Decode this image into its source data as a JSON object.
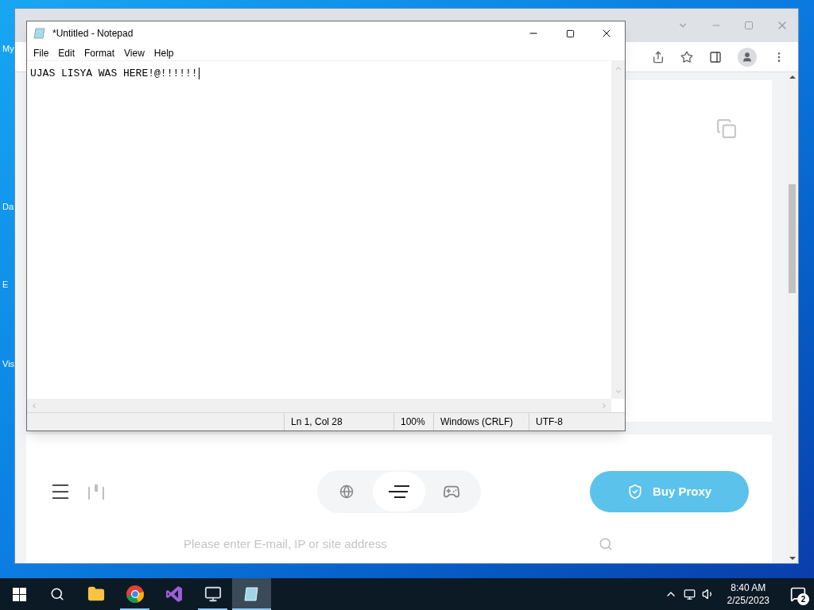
{
  "desktop": {
    "icons": [
      {
        "label": "My"
      },
      {
        "label": "Da"
      },
      {
        "label": "E"
      },
      {
        "label": "Vis"
      }
    ]
  },
  "browser": {
    "page": {
      "nav_tabs": [
        {
          "kind": "globe",
          "selected": false
        },
        {
          "kind": "list",
          "selected": true
        },
        {
          "kind": "gamepad",
          "selected": false
        }
      ],
      "buy_button": "Buy Proxy",
      "search": {
        "placeholder": "Please enter E-mail, IP or site address"
      }
    }
  },
  "notepad": {
    "title": "*Untitled - Notepad",
    "menu": [
      "File",
      "Edit",
      "Format",
      "View",
      "Help"
    ],
    "text": "UJAS LISYA WAS HERE!@!!!!!!",
    "status": [
      "Ln 1, Col 28",
      "100%",
      "Windows (CRLF)",
      "UTF-8"
    ]
  },
  "taskbar": {
    "apps": [
      {
        "kind": "explorer",
        "running": false,
        "selected": false
      },
      {
        "kind": "chrome",
        "running": true,
        "selected": false
      },
      {
        "kind": "studio",
        "running": false,
        "selected": false
      },
      {
        "kind": "monitor",
        "running": true,
        "selected": false
      },
      {
        "kind": "notepad",
        "running": true,
        "selected": true
      }
    ],
    "time": "8:40 AM",
    "date": "2/25/2023",
    "notifications": "2"
  }
}
